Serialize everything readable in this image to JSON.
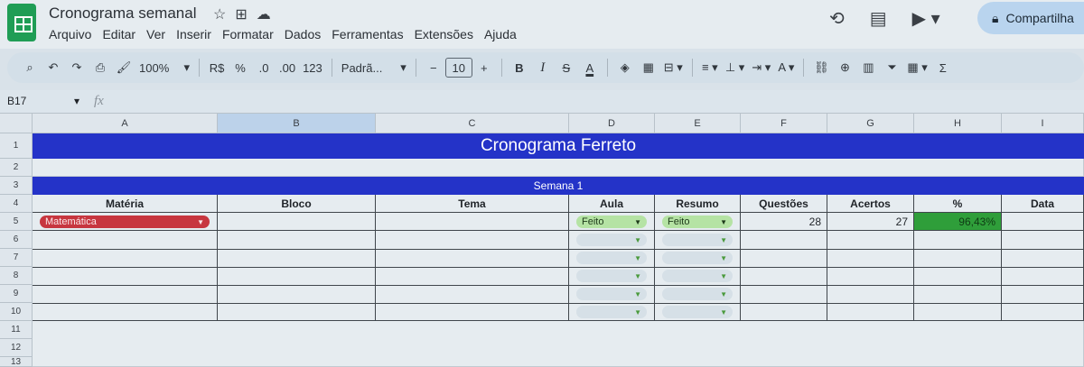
{
  "app": {
    "doc_title": "Cronograma semanal",
    "menu": [
      "Arquivo",
      "Editar",
      "Ver",
      "Inserir",
      "Formatar",
      "Dados",
      "Ferramentas",
      "Extensões",
      "Ajuda"
    ],
    "share_label": "Compartilha"
  },
  "toolbar": {
    "zoom": "100%",
    "currency": "R$",
    "percent": "%",
    "dec_less": ".0",
    "dec_more": ".00",
    "number_format": "123",
    "font": "Padrã...",
    "font_size": "10",
    "minus": "−",
    "plus": "+",
    "bold": "B",
    "italic": "I",
    "strike": "S",
    "text_color": "A",
    "sigma": "Σ"
  },
  "formula_bar": {
    "name_box": "B17",
    "fx": "fx"
  },
  "sheet": {
    "columns": [
      "A",
      "B",
      "C",
      "D",
      "E",
      "F",
      "G",
      "H",
      "I"
    ],
    "rows": [
      "1",
      "2",
      "3",
      "4",
      "5",
      "6",
      "7",
      "8",
      "9",
      "10",
      "11",
      "12",
      "13"
    ],
    "banner_title": "Cronograma Ferreto",
    "week_title": "Semana 1",
    "headers": [
      "Matéria",
      "Bloco",
      "Tema",
      "Aula",
      "Resumo",
      "Questões",
      "Acertos",
      "%",
      "Data"
    ],
    "row5": {
      "materia": "Matemática",
      "aula": "Feito",
      "resumo": "Feito",
      "questoes": "28",
      "acertos": "27",
      "percent": "96,43%"
    }
  },
  "colors": {
    "banner": "#2433c8",
    "chip_red": "#c7363f",
    "chip_green": "#b5e3a4",
    "percent_fill": "#2f9e3a",
    "selected_column": "#bcd2ea"
  }
}
